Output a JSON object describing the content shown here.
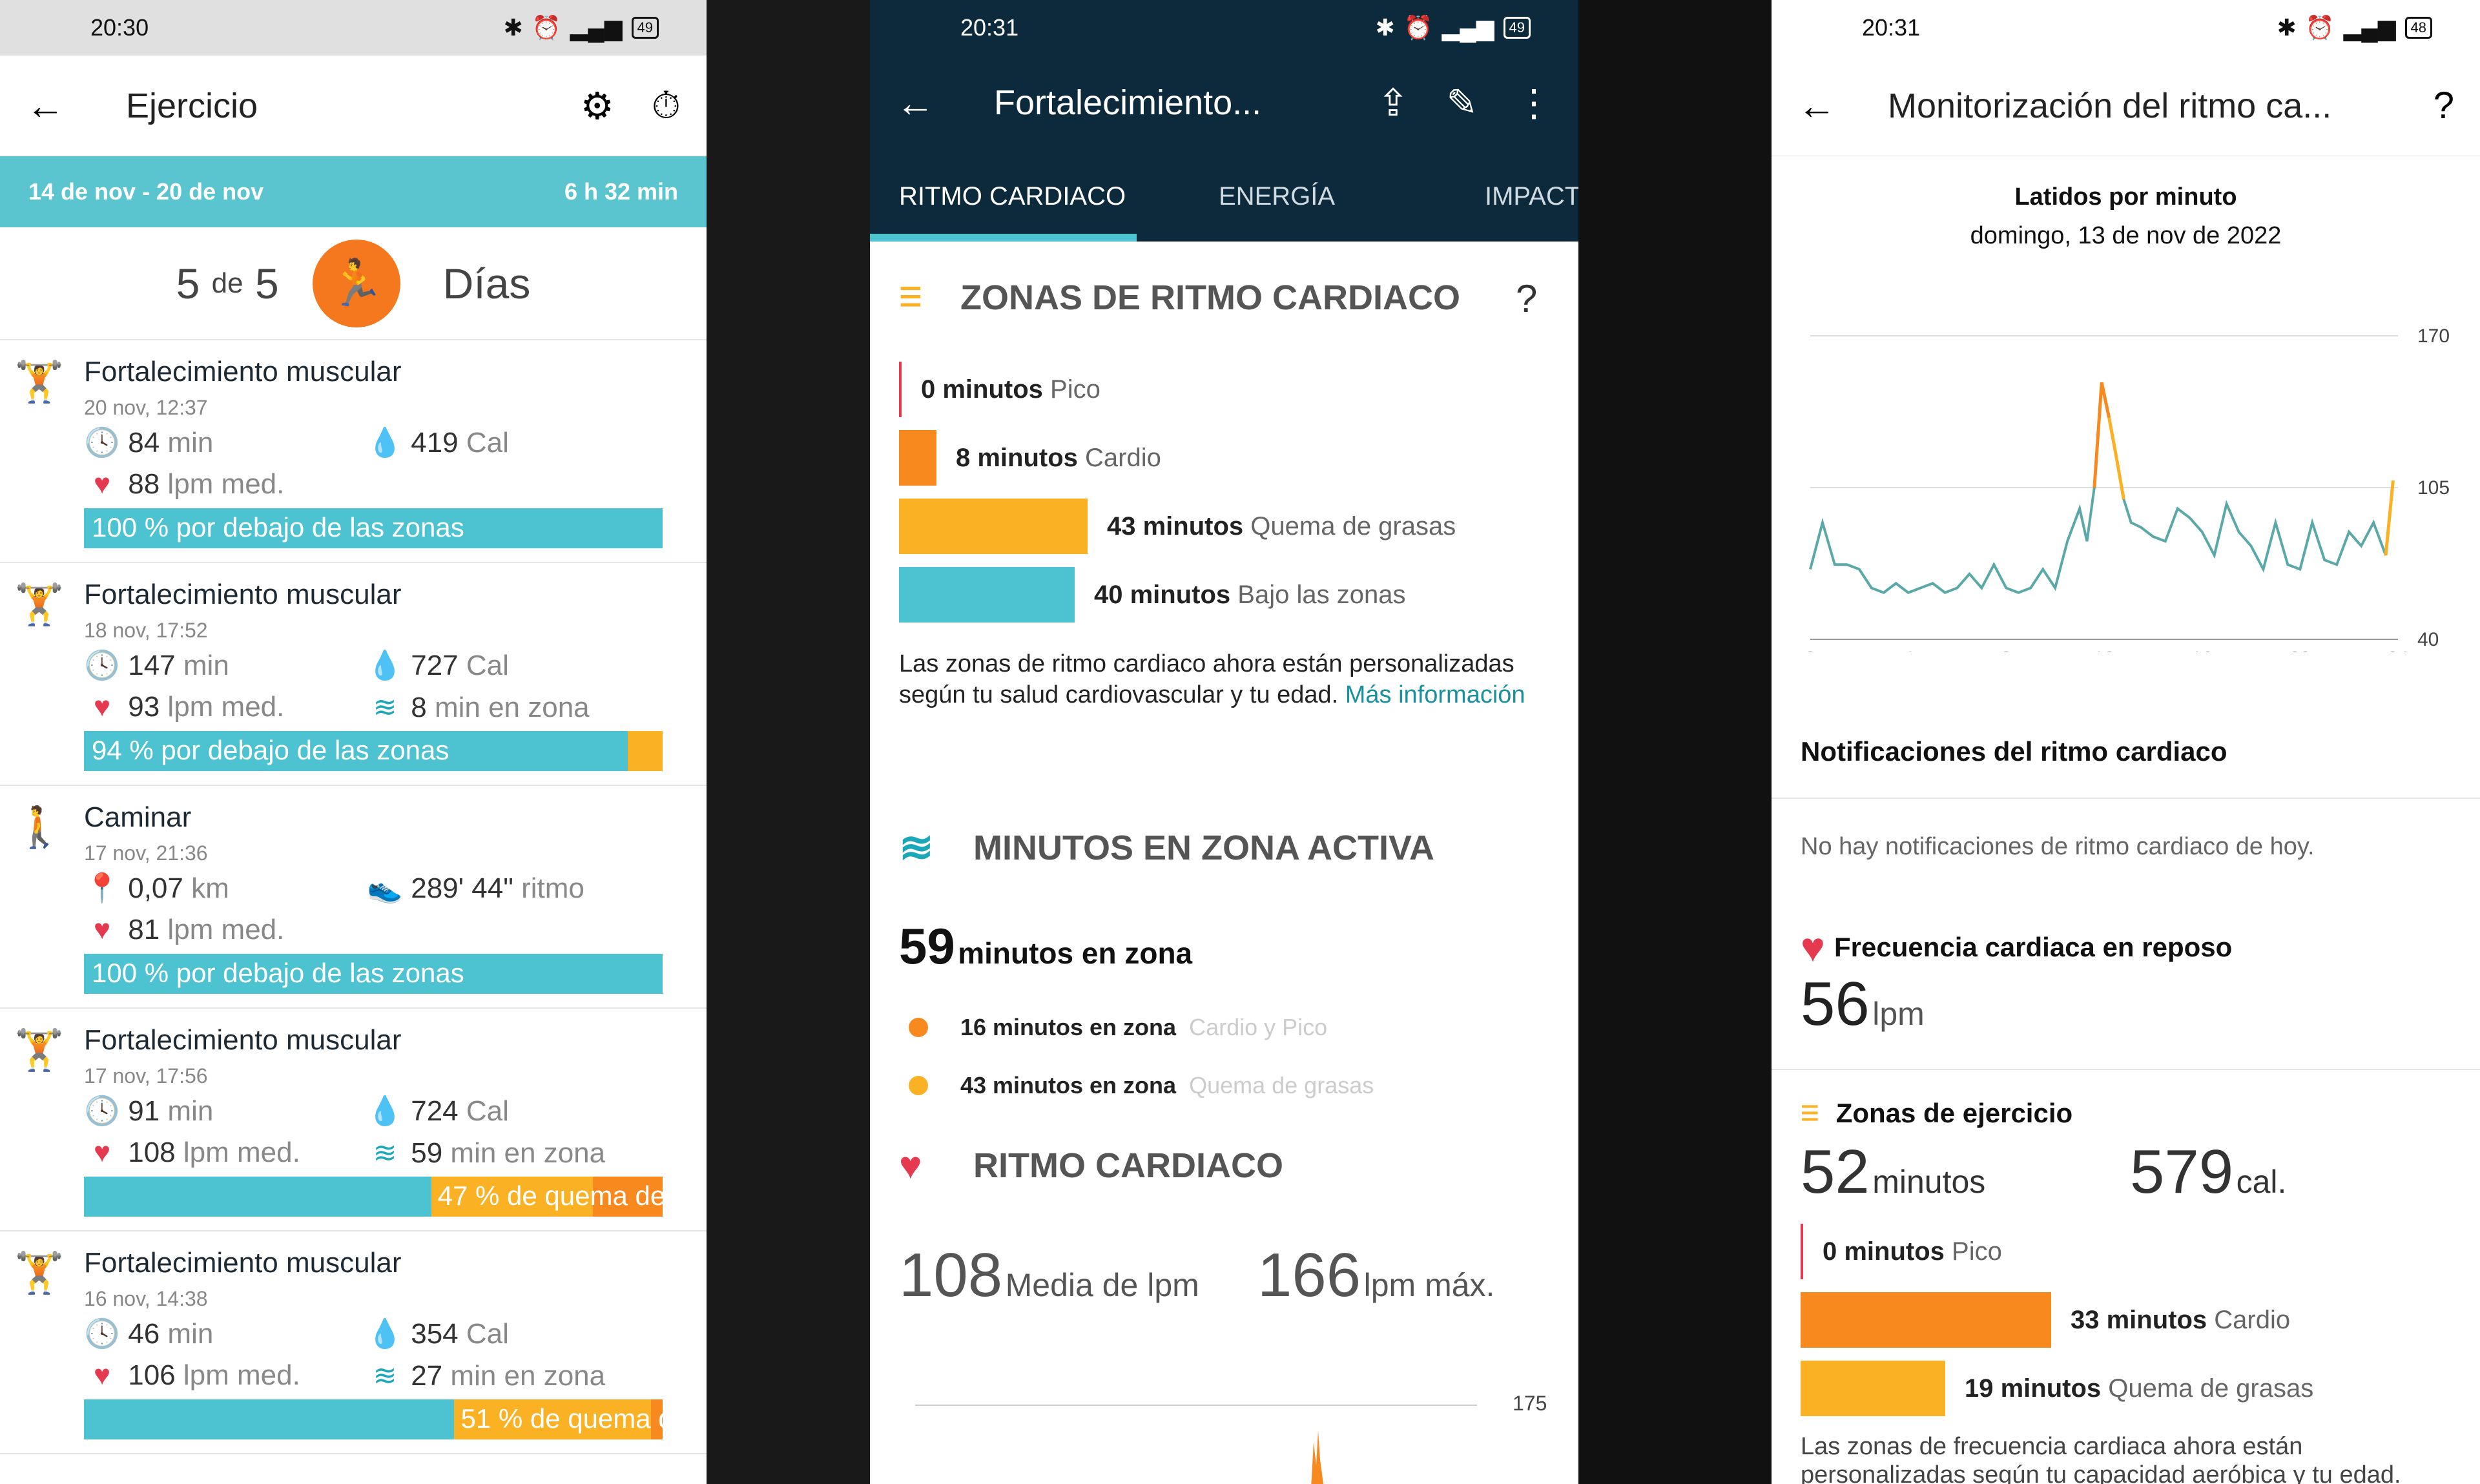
{
  "status": {
    "time_left": "20:30",
    "time_mid": "20:31",
    "time_right": "20:31",
    "batt_left": "49",
    "batt_mid": "49",
    "batt_right": "48",
    "net": "4G"
  },
  "p1": {
    "title": "Ejercicio",
    "week": "14 de nov - 20 de nov",
    "total": "6 h 32 min",
    "days_done": "5",
    "days_de": "de",
    "days_total": "5",
    "days_label": "Días",
    "activities": [
      {
        "name": "Fortalecimiento muscular",
        "date": "20 nov, 12:37",
        "s1": "84",
        "s1u": "min",
        "s2": "419",
        "s2u": "Cal",
        "s3": "88",
        "s3u": "lpm med.",
        "s4": "",
        "s4u": "",
        "bar": "100 % por debajo de las zonas",
        "icon": "weights-icon",
        "segs": [
          {
            "c": "#4dc3d1",
            "w": 1
          }
        ]
      },
      {
        "name": "Fortalecimiento muscular",
        "date": "18 nov, 17:52",
        "s1": "147",
        "s1u": "min",
        "s2": "727",
        "s2u": "Cal",
        "s3": "93",
        "s3u": "lpm med.",
        "s4": "8",
        "s4u": "min en zona",
        "bar": "94 % por debajo de las zonas",
        "icon": "weights-icon",
        "segs": [
          {
            "c": "#4dc3d1",
            "w": 0.94
          },
          {
            "c": "#fbb124",
            "w": 0.06
          }
        ]
      },
      {
        "name": "Caminar",
        "date": "17 nov, 21:36",
        "s1": "0,07",
        "s1u": "km",
        "s2": "289' 44\"",
        "s2u": "ritmo",
        "s3": "81",
        "s3u": "lpm med.",
        "s4": "",
        "s4u": "",
        "bar": "100 % por debajo de las zonas",
        "icon": "walk-icon",
        "segs": [
          {
            "c": "#4dc3d1",
            "w": 1
          }
        ]
      },
      {
        "name": "Fortalecimiento muscular",
        "date": "17 nov, 17:56",
        "s1": "91",
        "s1u": "min",
        "s2": "724",
        "s2u": "Cal",
        "s3": "108",
        "s3u": "lpm med.",
        "s4": "59",
        "s4u": "min en zona",
        "bar": "47 % de quema de...",
        "icon": "weights-icon",
        "segs": [
          {
            "c": "#4dc3d1",
            "w": 0.6
          },
          {
            "c": "#fbb124",
            "w": 0.28
          },
          {
            "c": "#f7891f",
            "w": 0.12
          }
        ]
      },
      {
        "name": "Fortalecimiento muscular",
        "date": "16 nov, 14:38",
        "s1": "46",
        "s1u": "min",
        "s2": "354",
        "s2u": "Cal",
        "s3": "106",
        "s3u": "lpm med.",
        "s4": "27",
        "s4u": "min en zona",
        "bar": "51 % de quema de gr...",
        "icon": "weights-icon",
        "segs": [
          {
            "c": "#4dc3d1",
            "w": 0.64
          },
          {
            "c": "#fbb124",
            "w": 0.34
          },
          {
            "c": "#f7891f",
            "w": 0.02
          }
        ]
      }
    ]
  },
  "p2": {
    "title": "Fortalecimiento...",
    "tabs": [
      "RITMO CARDIACO",
      "ENERGÍA",
      "IMPACT"
    ],
    "zones_title": "ZONAS DE RITMO CARDIACO",
    "help": "?",
    "zones": [
      {
        "v": "0 minutos",
        "l": "Pico"
      },
      {
        "v": "8 minutos",
        "l": "Cardio"
      },
      {
        "v": "43 minutos",
        "l": "Quema de grasas"
      },
      {
        "v": "40 minutos",
        "l": "Bajo las zonas"
      }
    ],
    "info": "Las zonas de ritmo cardiaco ahora están personalizadas según tu salud cardiovascular y tu edad.",
    "info_link": "Más información",
    "azm_title": "MINUTOS EN ZONA ACTIVA",
    "azm_value": "59",
    "azm_label": "minutos en zona",
    "azm_rows": [
      {
        "v": "16 minutos en zona",
        "l": "Cardio y Pico"
      },
      {
        "v": "43 minutos en zona",
        "l": "Quema de grasas"
      }
    ],
    "hr_title": "RITMO CARDIACO",
    "hr_avg": "108",
    "hr_avg_l": "Media de lpm",
    "hr_max": "166",
    "hr_max_l": "lpm máx.",
    "chart_tick": "175"
  },
  "p3": {
    "title": "Monitorización del ritmo ca...",
    "help": "?",
    "chart_title": "Latidos por minuto",
    "chart_date": "domingo, 13 de nov de 2022",
    "chart_data": {
      "type": "line",
      "title": "Latidos por minuto",
      "yticks": [
        170,
        105,
        40
      ],
      "xticks": [
        0,
        4,
        8,
        12,
        16,
        20,
        24
      ],
      "ylim": [
        40,
        170
      ],
      "x": [
        0,
        0.5,
        1,
        1.5,
        2,
        2.5,
        3,
        3.5,
        4,
        4.5,
        5,
        5.5,
        6,
        6.5,
        7,
        7.5,
        8,
        8.5,
        9,
        9.5,
        10,
        10.5,
        11,
        11.3,
        11.6,
        11.9,
        12.2,
        12.5,
        12.8,
        13.1,
        13.5,
        14,
        14.5,
        15,
        15.5,
        16,
        16.5,
        17,
        17.5,
        18,
        18.5,
        19,
        19.5,
        20,
        20.5,
        21,
        21.5,
        22,
        22.5,
        23,
        23.5,
        23.8
      ],
      "y": [
        70,
        90,
        72,
        72,
        70,
        62,
        60,
        64,
        60,
        62,
        64,
        60,
        62,
        68,
        62,
        72,
        62,
        60,
        62,
        70,
        62,
        82,
        96,
        82,
        105,
        150,
        135,
        118,
        100,
        90,
        88,
        84,
        82,
        96,
        92,
        86,
        76,
        98,
        86,
        80,
        70,
        90,
        72,
        70,
        90,
        74,
        72,
        86,
        80,
        90,
        76,
        108
      ]
    },
    "notif_title": "Notificaciones del ritmo cardiaco",
    "notif_text": "No hay notificaciones de ritmo cardiaco de hoy.",
    "rest_title": "Frecuencia cardiaca en reposo",
    "rest_value": "56",
    "rest_unit": "lpm",
    "ex_title": "Zonas de ejercicio",
    "ex_min": "52",
    "ex_min_u": "minutos",
    "ex_cal": "579",
    "ex_cal_u": "cal.",
    "zones": [
      {
        "v": "0 minutos",
        "l": "Pico"
      },
      {
        "v": "33 minutos",
        "l": "Cardio"
      },
      {
        "v": "19 minutos",
        "l": "Quema de grasas"
      }
    ],
    "footer": "Las zonas de frecuencia cardiaca ahora están personalizadas según tu capacidad aeróbica y tu edad."
  }
}
